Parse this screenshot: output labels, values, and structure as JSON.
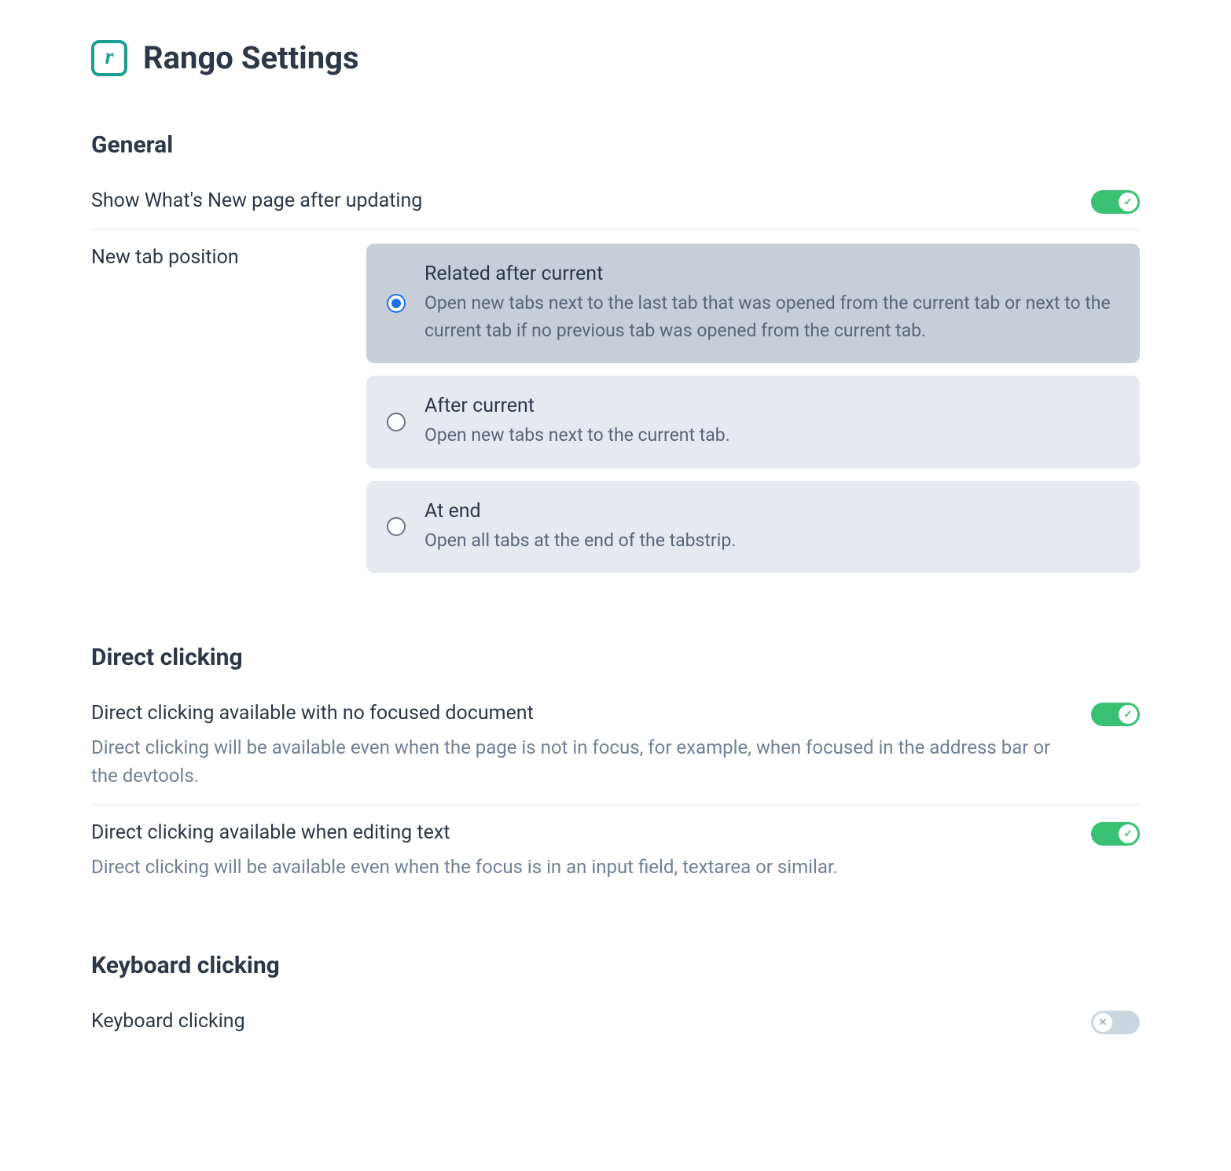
{
  "header": {
    "title": "Rango Settings"
  },
  "sections": {
    "general": {
      "title": "General",
      "showWhatsNew": {
        "label": "Show What's New page after updating",
        "value": true
      },
      "newTabPosition": {
        "label": "New tab position",
        "selected": 0,
        "options": [
          {
            "title": "Related after current",
            "description": "Open new tabs next to the last tab that was opened from the current tab or next to the current tab if no previous tab was opened from the current tab."
          },
          {
            "title": "After current",
            "description": "Open new tabs next to the current tab."
          },
          {
            "title": "At end",
            "description": "Open all tabs at the end of the tabstrip."
          }
        ]
      }
    },
    "directClicking": {
      "title": "Direct clicking",
      "noFocus": {
        "label": "Direct clicking available with no focused document",
        "description": "Direct clicking will be available even when the page is not in focus, for example, when focused in the address bar or the devtools.",
        "value": true
      },
      "editingText": {
        "label": "Direct clicking available when editing text",
        "description": "Direct clicking will be available even when the focus is in an input field, textarea or similar.",
        "value": true
      }
    },
    "keyboardClicking": {
      "title": "Keyboard clicking",
      "keyboard": {
        "label": "Keyboard clicking",
        "value": false
      }
    }
  }
}
